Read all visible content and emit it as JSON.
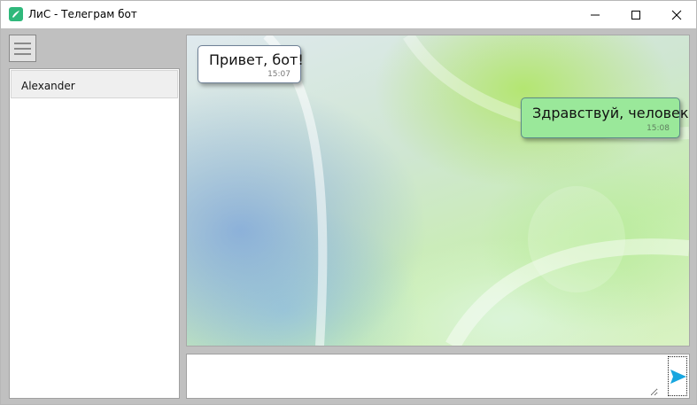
{
  "window": {
    "title": "ЛиС - Телеграм бот",
    "icon": "app-logo-icon",
    "controls": [
      "minimize-icon",
      "maximize-icon",
      "close-icon"
    ]
  },
  "sidebar": {
    "menu_icon": "hamburger-menu-icon",
    "contacts": [
      {
        "name": "Alexander",
        "selected": true
      }
    ]
  },
  "chat": {
    "messages": [
      {
        "direction": "incoming",
        "text": "Привет, бот!",
        "time": "15:07"
      },
      {
        "direction": "outgoing",
        "text": "Здравствуй, человек!",
        "time": "15:08"
      }
    ]
  },
  "composer": {
    "input_value": "",
    "send_icon": "send-arrow-icon"
  },
  "colors": {
    "outgoing_bubble": "#9ae89a",
    "incoming_bubble": "#ffffff",
    "send_arrow": "#18a6df",
    "app_icon": "#2fb87b"
  }
}
